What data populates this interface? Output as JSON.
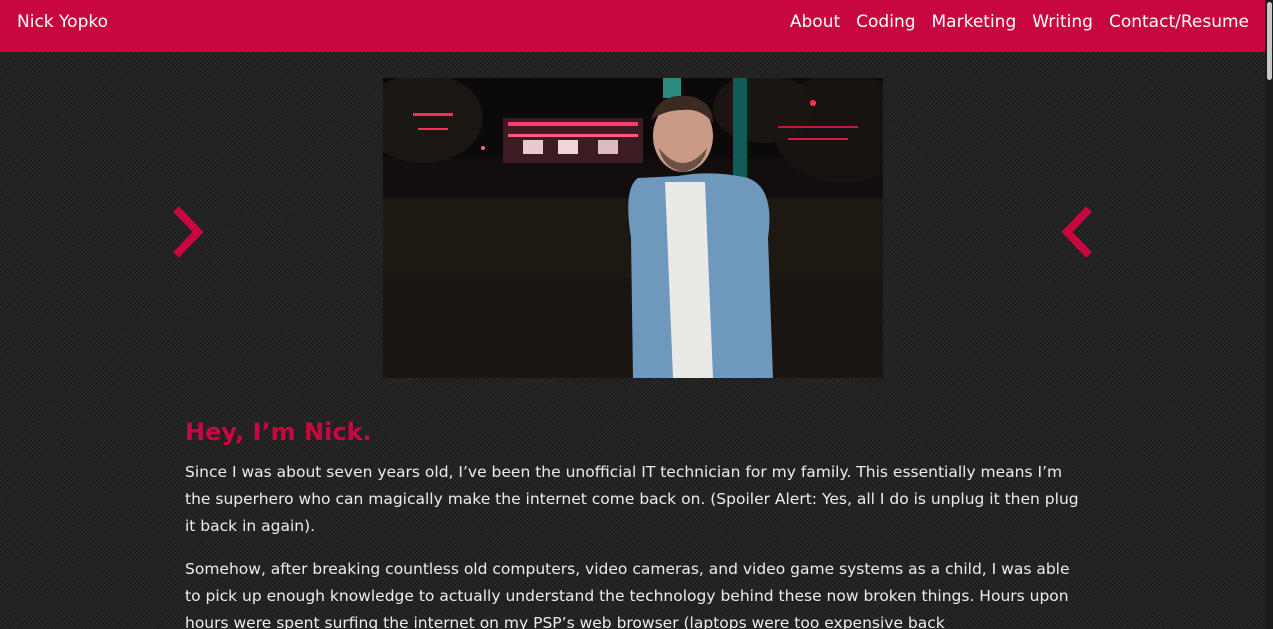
{
  "navbar": {
    "brand": "Nick Yopko",
    "links": [
      "About",
      "Coding",
      "Marketing",
      "Writing",
      "Contact/Resume"
    ],
    "color": "#c9073f"
  },
  "carousel": {
    "prev_icon": "chevron-right-icon",
    "next_icon": "chevron-left-icon",
    "arrow_color": "#c9073f"
  },
  "intro": {
    "heading": "Hey, I’m Nick.",
    "paragraphs": [
      "Since I was about seven years old, I’ve been the unofficial IT technician for my family. This essentially means I’m the superhero who can magically make the internet come back on. (Spoiler Alert: Yes, all I do is unplug it then plug it back in again).",
      "Somehow, after breaking countless old computers, video cameras, and video game systems as a child, I was able to pick up enough knowledge to actually understand the technology behind these now broken things. Hours upon hours were spent surfing the internet on my PSP’s web browser (laptops were too expensive back"
    ]
  }
}
